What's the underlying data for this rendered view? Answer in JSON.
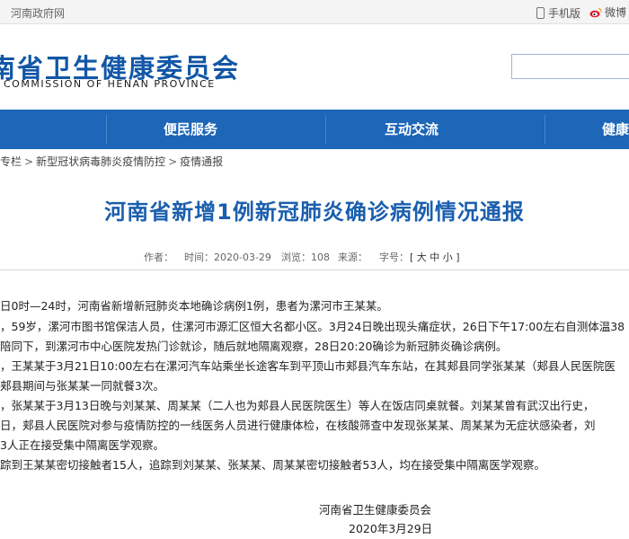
{
  "topbar": {
    "gov_link": "河南政府网",
    "mobile": "手机版",
    "weibo": "微博"
  },
  "header": {
    "title": "南省卫生健康委员会",
    "subtitle": "COMMISSION OF HENAN PROVINCE",
    "search_placeholder": ""
  },
  "nav": {
    "items": [
      {
        "label": "便民服务"
      },
      {
        "label": "互动交流"
      },
      {
        "label": "健康"
      }
    ]
  },
  "breadcrumb": {
    "items": [
      "专栏",
      "新型冠状病毒肺炎疫情防控",
      "疫情通报"
    ],
    "separator": ">"
  },
  "article": {
    "title": "河南省新增1例新冠肺炎确诊病例情况通报",
    "meta": {
      "author_label": "作者：",
      "time_label": "时间：2020-03-29",
      "views_label": "浏览：108",
      "source_label": "来源：",
      "fontsize_label": "字号：",
      "fontsize_options": "[ 大 中 小 ]"
    },
    "paragraphs": [
      "日0时—24时，河南省新增新冠肺炎本地确诊病例1例，患者为漯河市王某某。",
      "，59岁，漯河市图书馆保洁人员，住漯河市源汇区恒大名都小区。3月24日晚出现头痛症状，26日下午17:00左右自测体温38",
      "陪同下，到漯河市中心医院发热门诊就诊，随后就地隔离观察，28日20:20确诊为新冠肺炎确诊病例。",
      "，王某某于3月21日10:00左右在漯河汽车站乘坐长途客车到平顶山市郏县汽车东站，在其郏县同学张某某（郏县人民医院医",
      "郏县期间与张某某一同就餐3次。",
      "，张某某于3月13日晚与刘某某、周某某（二人也为郏县人民医院医生）等人在饭店同桌就餐。刘某某曾有武汉出行史，",
      "日，郏县人民医院对参与疫情防控的一线医务人员进行健康体检，在核酸筛查中发现张某某、周某某为无症状感染者，刘",
      "3人正在接受集中隔离医学观察。",
      "踪到王某某密切接触者15人，追踪到刘某某、张某某、周某某密切接触者53人，均在接受集中隔离医学观察。"
    ],
    "signature_org": "河南省卫生健康委员会",
    "signature_date": "2020年3月29日"
  },
  "colors": {
    "brand_blue": "#1d66b8",
    "title_blue": "#1b5fae"
  }
}
